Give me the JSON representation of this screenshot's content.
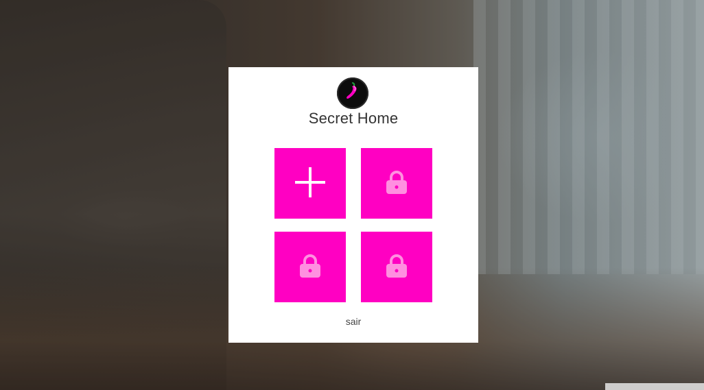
{
  "app": {
    "title": "Secret Home"
  },
  "logo": {
    "icon": "chili-pepper-icon",
    "accent": "#ff00c2"
  },
  "tiles": [
    {
      "name": "add-tile",
      "icon": "plus-icon"
    },
    {
      "name": "locked-slot-1",
      "icon": "lock-icon"
    },
    {
      "name": "locked-slot-2",
      "icon": "lock-icon"
    },
    {
      "name": "locked-slot-3",
      "icon": "lock-icon"
    }
  ],
  "actions": {
    "exit_label": "sair"
  },
  "colors": {
    "tile": "#ff00c2",
    "panel": "#ffffff",
    "lock_icon": "#ff8fe0"
  }
}
